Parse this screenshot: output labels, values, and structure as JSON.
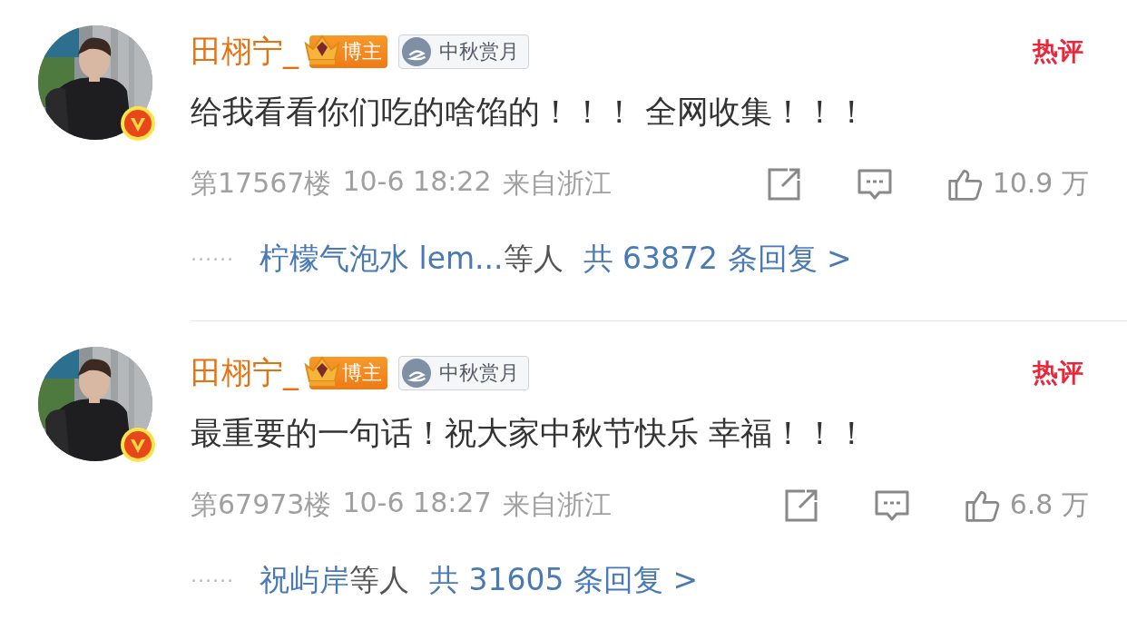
{
  "comments": [
    {
      "user": {
        "name": "田栩宁_",
        "verified": true,
        "badges": [
          {
            "kind": "blogger",
            "label": "博主"
          },
          {
            "kind": "medal",
            "label": "中秋赏月"
          }
        ]
      },
      "hot_label": "热评",
      "content": "给我看看你们吃的啥馅的！！！ 全网收集！！！",
      "floor": "第17567楼",
      "time": "10-6 18:22",
      "location": "来自浙江",
      "like_count": "10.9 万",
      "replies": {
        "dots": "······",
        "names": "柠檬气泡水 lem...",
        "suffix": "等人",
        "count": "共 63872 条回复 >"
      }
    },
    {
      "user": {
        "name": "田栩宁_",
        "verified": true,
        "badges": [
          {
            "kind": "blogger",
            "label": "博主"
          },
          {
            "kind": "medal",
            "label": "中秋赏月"
          }
        ]
      },
      "hot_label": "热评",
      "content": "最重要的一句话！祝大家中秋节快乐 幸福！！！",
      "floor": "第67973楼",
      "time": "10-6 18:27",
      "location": "来自浙江",
      "like_count": "6.8 万",
      "replies": {
        "dots": "······",
        "names": "祝屿岸",
        "suffix": "等人",
        "count": "共 31605 条回复 >"
      }
    }
  ]
}
